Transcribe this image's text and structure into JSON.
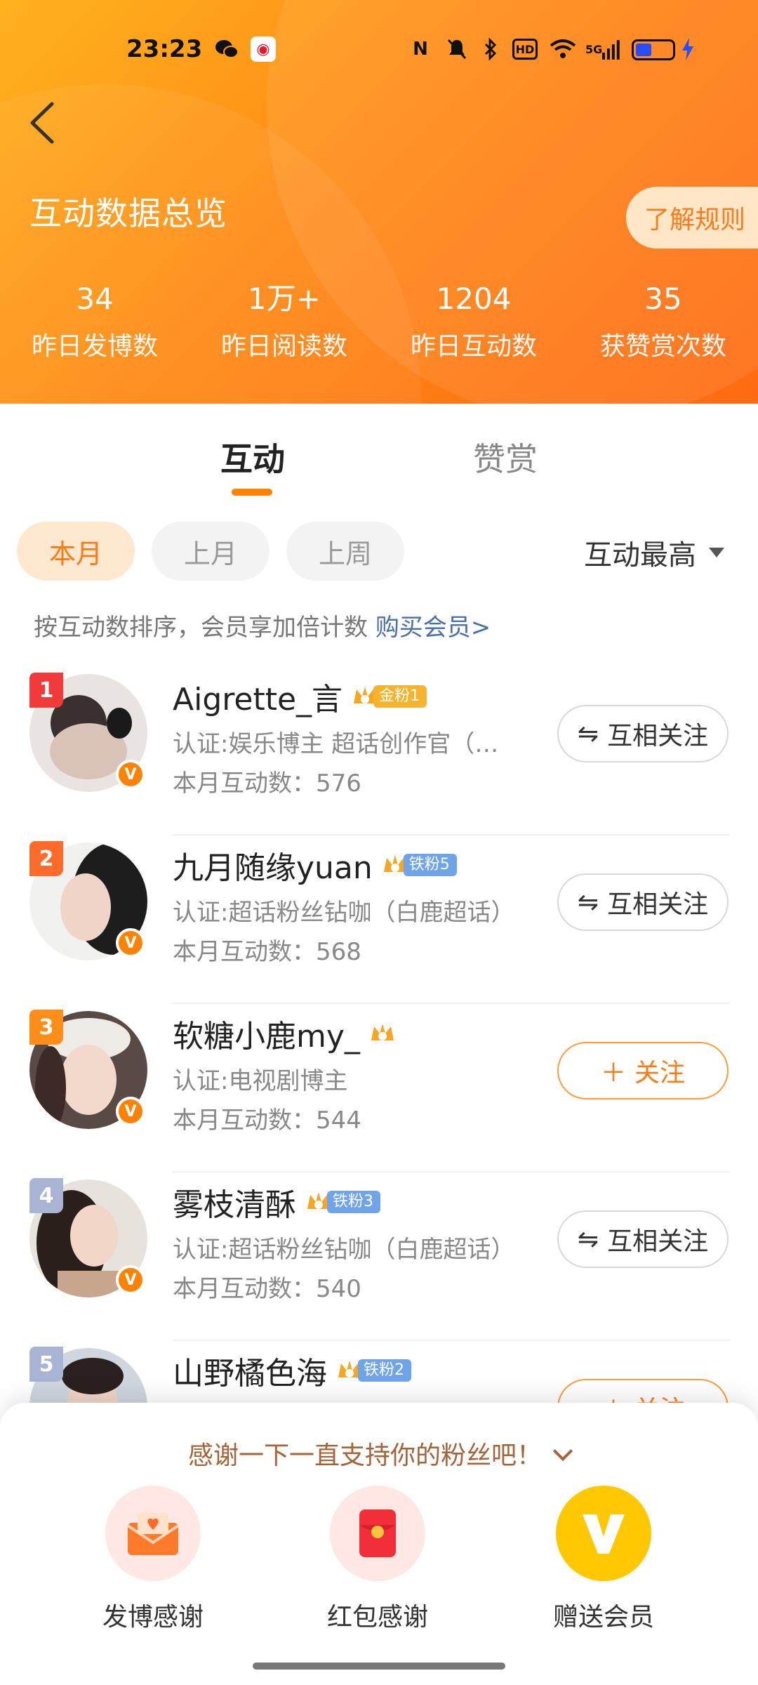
{
  "status_bar": {
    "time": "23:23",
    "icons": [
      "wechat-icon",
      "weibo-icon",
      "nfc-icon",
      "mute-icon",
      "bluetooth-icon",
      "hd-icon",
      "wifi-icon",
      "signal-icon",
      "battery-icon",
      "charging-icon"
    ],
    "signal_label": "5G"
  },
  "header": {
    "title": "互动数据总览",
    "rules_button": "了解规则",
    "stats": [
      {
        "value": "34",
        "label": "昨日发博数"
      },
      {
        "value": "1万+",
        "label": "昨日阅读数"
      },
      {
        "value": "1204",
        "label": "昨日互动数"
      },
      {
        "value": "35",
        "label": "获赞赏次数"
      }
    ]
  },
  "tabs": [
    {
      "label": "互动",
      "active": true
    },
    {
      "label": "赞赏",
      "active": false
    }
  ],
  "filters": {
    "chips": [
      {
        "label": "本月",
        "active": true
      },
      {
        "label": "上月",
        "active": false
      },
      {
        "label": "上周",
        "active": false
      }
    ],
    "sort_label": "互动最高"
  },
  "hint": {
    "text": "按互动数排序，会员享加倍计数 ",
    "link": "购买会员>"
  },
  "users": [
    {
      "rank": "1",
      "name": "Aigrette_言",
      "badge": "金粉1",
      "badge_type": "gold",
      "cert": "认证:娱乐博主 超话创作官（…",
      "count": "本月互动数：576",
      "button": "互相关注",
      "button_type": "mutual"
    },
    {
      "rank": "2",
      "name": "九月随缘yuan",
      "badge": "铁粉5",
      "badge_type": "iron",
      "cert": "认证:超话粉丝钻咖（白鹿超话）",
      "count": "本月互动数：568",
      "button": "互相关注",
      "button_type": "mutual"
    },
    {
      "rank": "3",
      "name": "软糖小鹿my_",
      "badge": "",
      "badge_type": "crown-only",
      "cert": "认证:电视剧博主",
      "count": "本月互动数：544",
      "button": "关注",
      "button_type": "follow"
    },
    {
      "rank": "4",
      "name": "雾枝清酥",
      "badge": "铁粉3",
      "badge_type": "iron",
      "cert": "认证:超话粉丝钻咖（白鹿超话）",
      "count": "本月互动数：540",
      "button": "互相关注",
      "button_type": "mutual"
    },
    {
      "rank": "5",
      "name": "山野橘色海",
      "badge": "铁粉2",
      "badge_type": "iron",
      "cert": "",
      "count": "",
      "button": "关注",
      "button_type": "follow"
    }
  ],
  "bottom_sheet": {
    "title": "感谢一下一直支持你的粉丝吧！",
    "actions": [
      {
        "label": "发博感谢",
        "icon": "envelope-heart-icon"
      },
      {
        "label": "红包感谢",
        "icon": "red-envelope-icon"
      },
      {
        "label": "赠送会员",
        "icon": "vip-v-icon"
      }
    ]
  },
  "colors": {
    "accent": "#ff8200",
    "header_start": "#ffb21e",
    "header_end": "#ff6a12",
    "link": "#4a6fa8"
  }
}
